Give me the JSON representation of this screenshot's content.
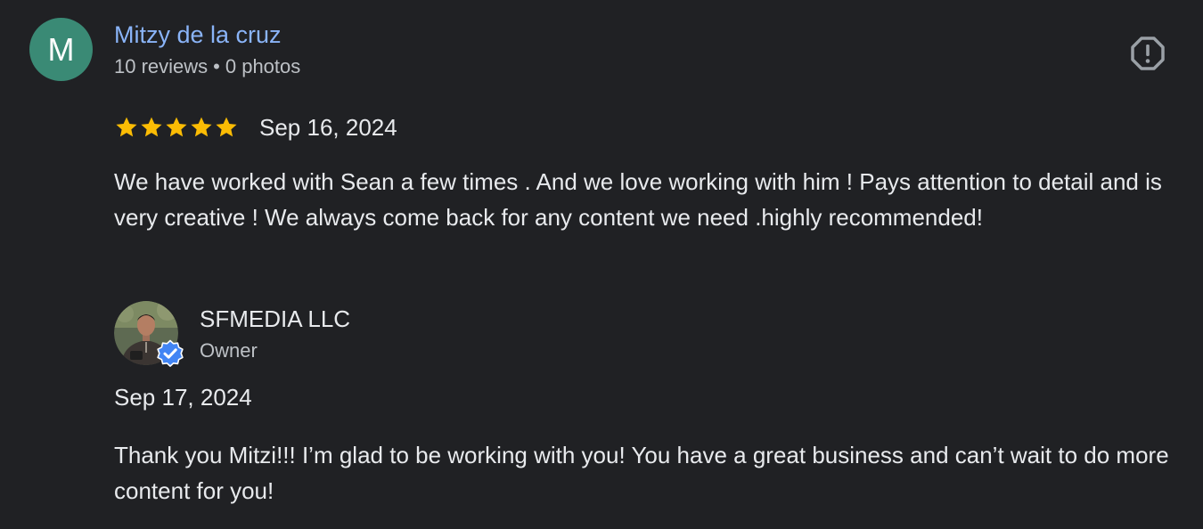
{
  "review": {
    "author": {
      "initial": "M",
      "avatar_color": "#3a8a75",
      "name": "Mitzy de la cruz",
      "name_color": "#8ab4f8",
      "reviews_count": "10 reviews",
      "separator": "•",
      "photos_count": "0 photos"
    },
    "flag_icon": "report-flag-icon",
    "rating": 5,
    "max_rating": 5,
    "star_color": "#fbbc04",
    "date": "Sep 16, 2024",
    "text": "We have worked with Sean a few times . And we love working with him ! Pays attention to detail and is very creative ! We always come back for any content we need .highly recommended!"
  },
  "owner_response": {
    "name": "SFMEDIA LLC",
    "role": "Owner",
    "badge_icon": "verified-check-icon",
    "badge_color": "#1a73e8",
    "date": "Sep 17, 2024",
    "text": "Thank you Mitzi!!! I’m glad to be working with you! You have a great business and can’t wait to do more content for you!"
  }
}
